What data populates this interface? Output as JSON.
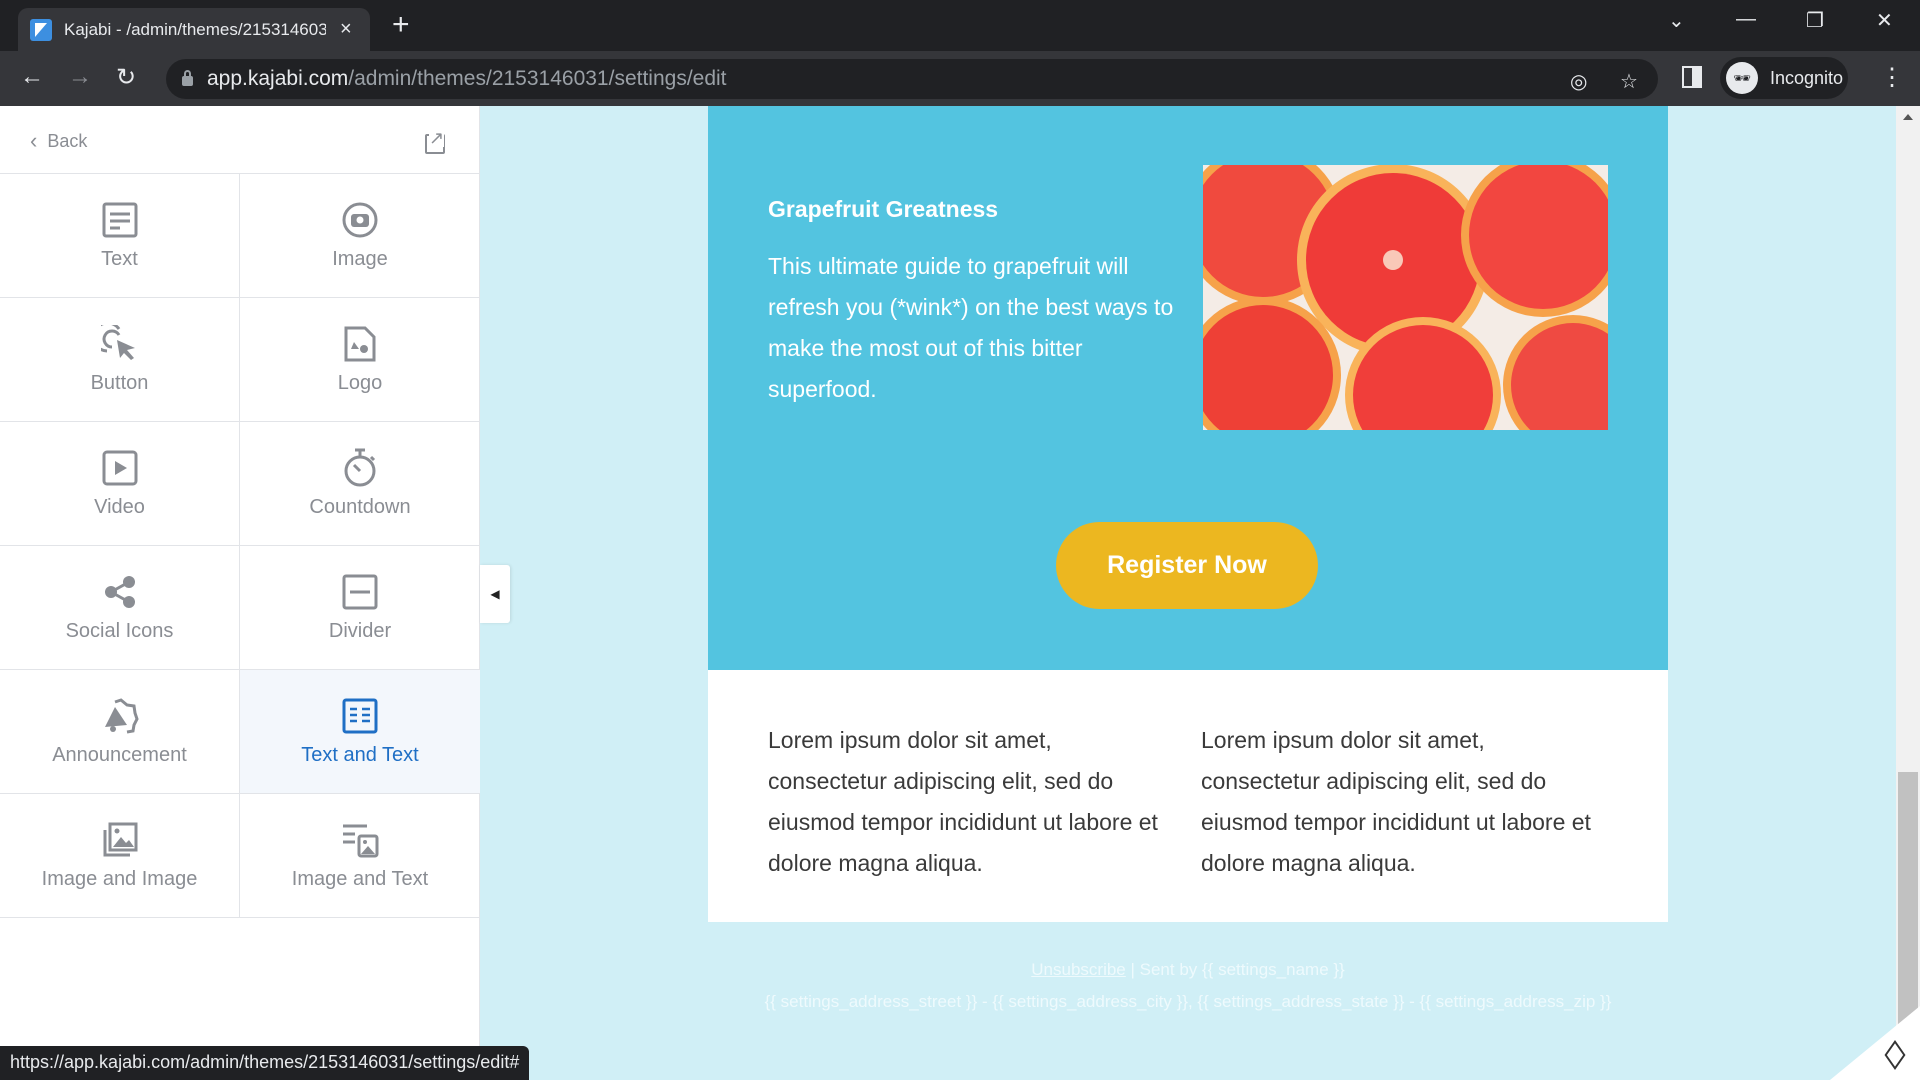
{
  "browser": {
    "tab_title": "Kajabi - /admin/themes/2153146031/settings/edit",
    "tab_close": "×",
    "new_tab": "+",
    "url_host": "app.kajabi.com",
    "url_path": "/admin/themes/2153146031/settings/edit",
    "incognito_label": "Incognito",
    "status_url": "https://app.kajabi.com/admin/themes/2153146031/settings/edit#",
    "icons": {
      "back": "←",
      "forward": "→",
      "reload": "↻",
      "star": "☆",
      "eye_off": "◎",
      "menu": "⋮",
      "tab_search": "⌄",
      "minimize": "—",
      "restore": "❐",
      "close": "✕"
    }
  },
  "sidebar": {
    "back_label": "Back",
    "items": [
      {
        "label": "Text",
        "icon": "text-icon"
      },
      {
        "label": "Image",
        "icon": "camera-icon"
      },
      {
        "label": "Button",
        "icon": "click-icon"
      },
      {
        "label": "Logo",
        "icon": "logo-file-icon"
      },
      {
        "label": "Video",
        "icon": "play-icon"
      },
      {
        "label": "Countdown",
        "icon": "stopwatch-icon"
      },
      {
        "label": "Social Icons",
        "icon": "share-icon"
      },
      {
        "label": "Divider",
        "icon": "divider-icon"
      },
      {
        "label": "Announcement",
        "icon": "megaphone-icon"
      },
      {
        "label": "Text and Text",
        "icon": "text-and-text-icon",
        "active": true
      },
      {
        "label": "Image and Image",
        "icon": "images-icon"
      },
      {
        "label": "Image and Text",
        "icon": "image-text-icon"
      }
    ]
  },
  "email": {
    "hero_heading": "Grapefruit Greatness",
    "hero_body": "This ultimate guide to grapefruit will refresh you (*wink*) on the best ways to make the most out of this bitter superfood.",
    "cta_label": "Register Now",
    "col1": "Lorem ipsum dolor sit amet, consectetur adipiscing elit, sed do eiusmod tempor incididunt ut labore et dolore magna aliqua.",
    "col2": "Lorem ipsum dolor sit amet, consectetur adipiscing elit, sed do eiusmod tempor incididunt ut labore et dolore magna aliqua.",
    "footer_unsubscribe": "Unsubscribe",
    "footer_sent_by": " | Sent by {{ settings_name }}",
    "footer_address": "{{ settings_address_street }} - {{ settings_address_city }}, {{ settings_address_state }} - {{ settings_address_zip }}",
    "colors": {
      "hero_bg": "#53c4e0",
      "cta_bg": "#ecb720",
      "page_bg": "#d0eff6",
      "active_accent": "#1f6fc5"
    }
  }
}
